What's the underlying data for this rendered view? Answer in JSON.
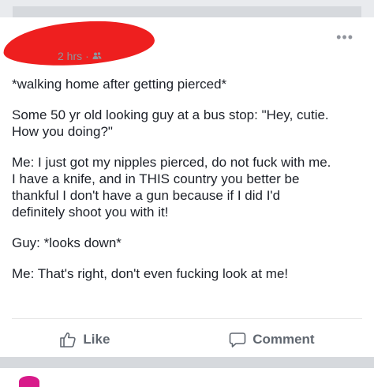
{
  "post": {
    "timestamp": "2 hrs",
    "separator": "·",
    "audience_icon": "friends-icon",
    "paragraphs": [
      "*walking home after getting pierced*",
      "Some 50 yr old looking guy at a bus stop: \"Hey, cutie.\nHow you doing?\"",
      "Me: I just got my nipples pierced, do not fuck with me.\nI have a knife, and in THIS country you better be\nthankful I don't have a gun because if I did I'd\ndefinitely shoot you with it!",
      "Guy: *looks down*",
      "Me: That's right, don't even fucking look at me!"
    ]
  },
  "actions": {
    "like_label": "Like",
    "comment_label": "Comment"
  },
  "colors": {
    "redaction": "#ee1f1f",
    "meta_text": "#90949c",
    "action_text": "#606770"
  }
}
